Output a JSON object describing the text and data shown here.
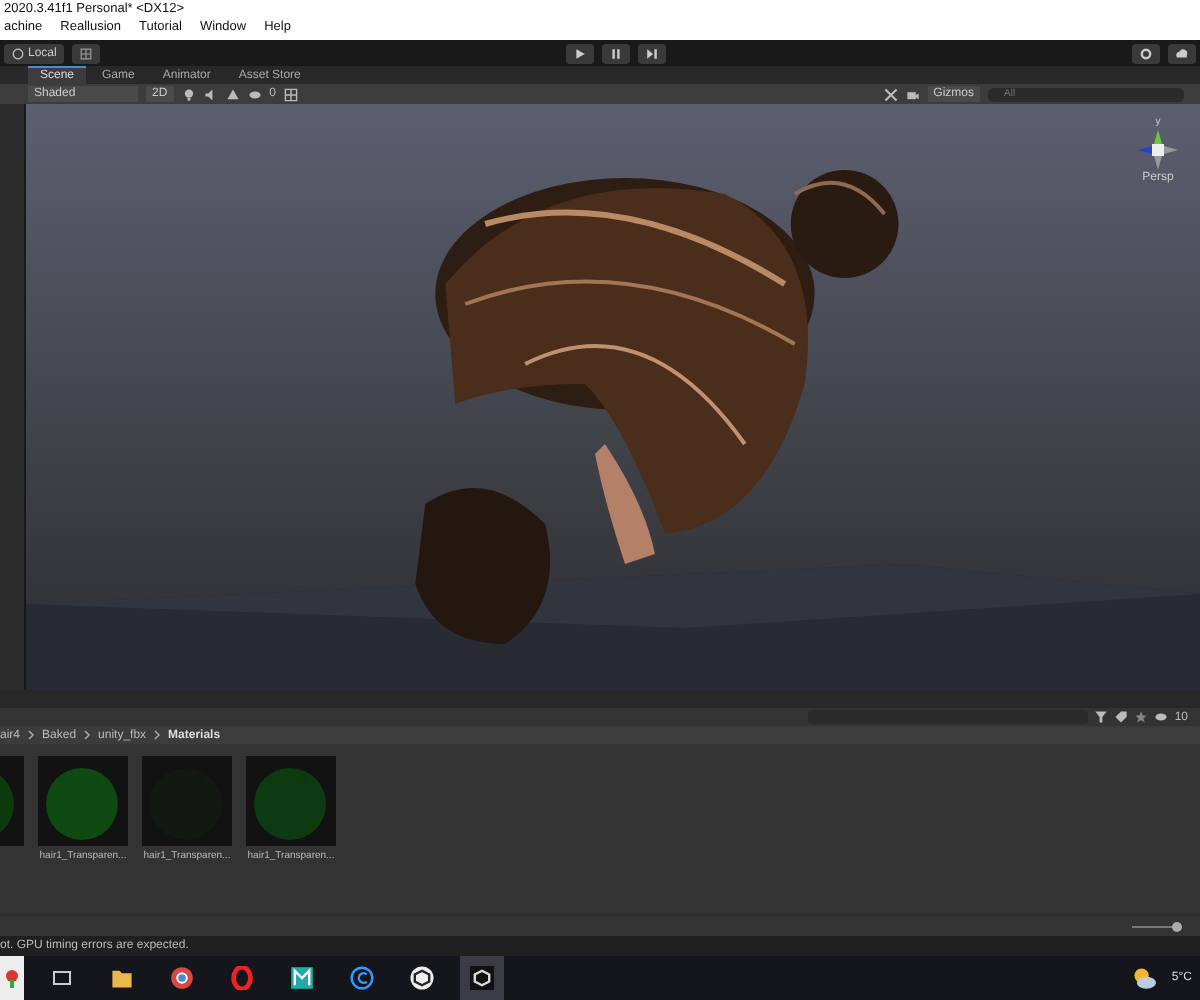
{
  "window": {
    "title": "2020.3.41f1 Personal* <DX12>"
  },
  "menu": [
    "achine",
    "Reallusion",
    "Tutorial",
    "Window",
    "Help"
  ],
  "toolbar": {
    "pivot": "Local"
  },
  "tabs": [
    {
      "label": "Scene",
      "selected": true
    },
    {
      "label": "Game",
      "selected": false
    },
    {
      "label": "Animator",
      "selected": false
    },
    {
      "label": "Asset Store",
      "selected": false
    }
  ],
  "scene_toolbar": {
    "shading": "Shaded",
    "mode_2d": "2D",
    "gizmos": "Gizmos",
    "search_placeholder": "All",
    "hidden_count": "0"
  },
  "scene": {
    "axis": "y",
    "projection": "Persp"
  },
  "project": {
    "breadcrumb": [
      {
        "label": "air4",
        "current": false
      },
      {
        "label": "Baked",
        "current": false
      },
      {
        "label": "unity_fbx",
        "current": false
      },
      {
        "label": "Materials",
        "current": true
      }
    ],
    "hidden_count": "10",
    "zoom": {
      "level": 0.95
    },
    "assets": [
      {
        "kind": "picture"
      },
      {
        "kind": "picture",
        "name": "hair1_Transparen..."
      },
      {
        "kind": "picture",
        "name": "hair1_Transparen..."
      },
      {
        "kind": "picture",
        "name": "hair1_Transparen..."
      }
    ]
  },
  "status_bar": "ot. GPU timing errors are expected.",
  "taskbar": {
    "temperature": "5°C"
  }
}
